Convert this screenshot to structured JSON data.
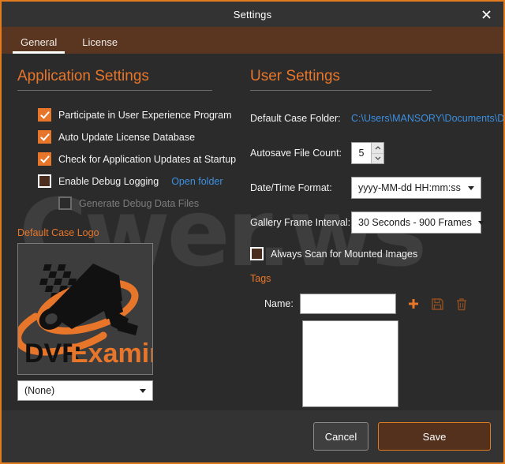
{
  "window": {
    "title": "Settings",
    "close_icon": "close-icon"
  },
  "tabs": [
    {
      "label": "General",
      "active": true
    },
    {
      "label": "License",
      "active": false
    }
  ],
  "application_settings": {
    "heading": "Application Settings",
    "checkboxes": [
      {
        "label": "Participate in User Experience Program",
        "state": "checked"
      },
      {
        "label": "Auto Update License Database",
        "state": "checked"
      },
      {
        "label": "Check for Application Updates at Startup",
        "state": "checked"
      },
      {
        "label": "Enable Debug Logging",
        "state": "unchecked"
      },
      {
        "label": "Generate Debug Data Files",
        "state": "disabled"
      }
    ],
    "open_folder_link": "Open folder",
    "logo_caption": "Default Case Logo",
    "logo_alt": "DVR Examiner",
    "logo_text_dark": "DVR",
    "logo_text_orange": "Examiner",
    "logo_select_value": "(None)"
  },
  "user_settings": {
    "heading": "User Settings",
    "default_case_folder_label": "Default Case Folder:",
    "default_case_folder_value": "C:\\Users\\MANSORY\\Documents\\DV...",
    "autosave_label": "Autosave File Count:",
    "autosave_value": "5",
    "datetime_label": "Date/Time Format:",
    "datetime_value": "yyyy-MM-dd HH:mm:ss",
    "gallery_label": "Gallery Frame Interval:",
    "gallery_value": "30 Seconds - 900 Frames",
    "always_scan_label": "Always Scan for Mounted Images",
    "always_scan_state": "unchecked",
    "tags_caption": "Tags",
    "tag_name_label": "Name:",
    "tag_name_value": "",
    "tag_name_placeholder": "",
    "tag_add_icon": "plus-icon",
    "tag_save_icon": "save-disk-icon",
    "tag_delete_icon": "trash-icon"
  },
  "footer": {
    "cancel_label": "Cancel",
    "save_label": "Save"
  },
  "watermark": {
    "text": "Cwer.ws"
  },
  "colors": {
    "accent_orange": "#e8762a",
    "border_orange": "#e07b20",
    "tab_strip_brown": "#5a3520",
    "link_blue": "#3d8fe0",
    "window_bg": "#2b2b2b",
    "titlebar_bg": "#333333",
    "save_button_bg": "#53311d"
  }
}
